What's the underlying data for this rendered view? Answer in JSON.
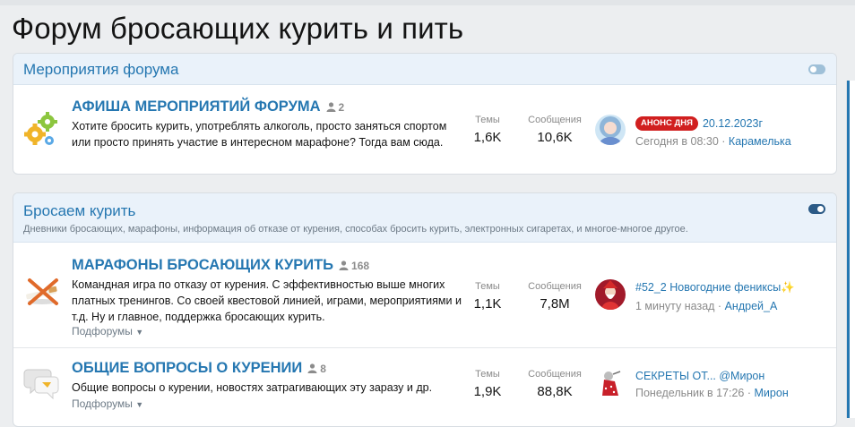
{
  "page": {
    "title": "Форум бросающих курить и пить"
  },
  "categories": [
    {
      "title": "Мероприятия форума",
      "description": "",
      "nodes": [
        {
          "title": "АФИША МЕРОПРИЯТИЙ ФОРУМА",
          "online": "2",
          "description": "Хотите бросить курить, употреблять алкоголь, просто заняться спортом или просто принять участие в интересном марафоне? Тогда вам сюда.",
          "threads_label": "Темы",
          "threads": "1,6K",
          "messages_label": "Сообщения",
          "messages": "10,6K",
          "last_badge": "АНОНС ДНЯ",
          "last_title": "20.12.2023г",
          "last_time": "Сегодня в 08:30",
          "last_user": "Карамелька"
        }
      ]
    },
    {
      "title": "Бросаем курить",
      "description": "Дневники бросающих, марафоны, информация об отказе от курения, способах бросить курить, электронных сигаретах, и многое-многое другое.",
      "nodes": [
        {
          "title": "МАРАФОНЫ БРОСАЮЩИХ КУРИТЬ",
          "online": "168",
          "description": "Командная игра по отказу от курения. С эффективностью выше многих платных тренингов. Со своей квестовой линией, играми, мероприятиями и т.д. Ну и главное, поддержка бросающих курить.",
          "subforums": "Подфорумы",
          "threads_label": "Темы",
          "threads": "1,1K",
          "messages_label": "Сообщения",
          "messages": "7,8M",
          "last_title": "#52_2 Новогодние фениксы✨",
          "last_time": "1 минуту назад",
          "last_user": "Андрей_А"
        },
        {
          "title": "ОБЩИЕ ВОПРОСЫ О КУРЕНИИ",
          "online": "8",
          "description": "Общие вопросы о курении, новостях затрагивающих эту заразу и др.",
          "subforums": "Подфорумы",
          "threads_label": "Темы",
          "threads": "1,9K",
          "messages_label": "Сообщения",
          "messages": "88,8K",
          "last_title": "СЕКРЕТЫ ОТ... @Мирон",
          "last_time": "Понедельник в 17:26",
          "last_user": "Мирон"
        }
      ]
    }
  ],
  "separator": "·",
  "colors": {
    "accent": "#2577b1",
    "badge": "#d11f1f",
    "header_bg": "#eaf2fa"
  }
}
